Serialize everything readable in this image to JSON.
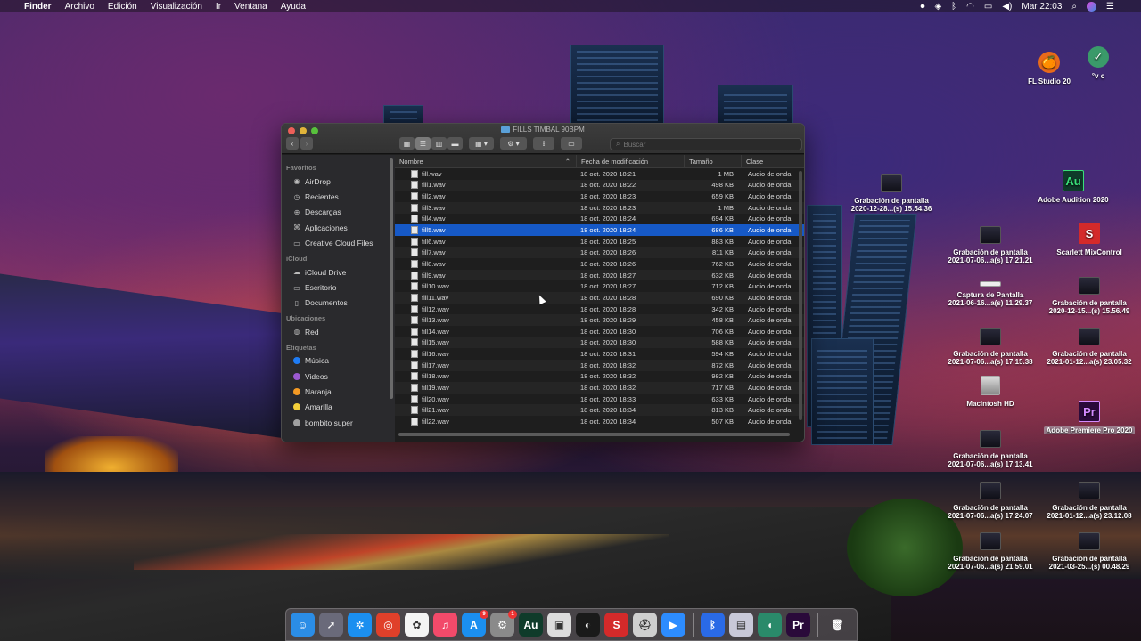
{
  "menubar": {
    "apple": "",
    "app": "Finder",
    "menus": [
      "Archivo",
      "Edición",
      "Visualización",
      "Ir",
      "Ventana",
      "Ayuda"
    ],
    "clock": "Mar 22:03"
  },
  "window": {
    "title": "FILLS TIMBAL 90BPM",
    "search_placeholder": "Buscar"
  },
  "sidebar": {
    "sections": [
      {
        "header": "Favoritos",
        "items": [
          {
            "label": "AirDrop",
            "icon": "airdrop-icon",
            "glyph": "◉"
          },
          {
            "label": "Recientes",
            "icon": "clock-icon",
            "glyph": "◷"
          },
          {
            "label": "Descargas",
            "icon": "download-icon",
            "glyph": "⊕"
          },
          {
            "label": "Aplicaciones",
            "icon": "applications-icon",
            "glyph": "⌘"
          },
          {
            "label": "Creative Cloud Files",
            "icon": "folder-icon",
            "glyph": "▭"
          }
        ]
      },
      {
        "header": "iCloud",
        "items": [
          {
            "label": "iCloud Drive",
            "icon": "cloud-icon",
            "glyph": "☁"
          },
          {
            "label": "Escritorio",
            "icon": "desktop-icon",
            "glyph": "▭"
          },
          {
            "label": "Documentos",
            "icon": "document-icon",
            "glyph": "▯"
          }
        ]
      },
      {
        "header": "Ubicaciones",
        "items": [
          {
            "label": "Red",
            "icon": "network-icon",
            "glyph": "◍"
          }
        ]
      },
      {
        "header": "Etiquetas",
        "items": [
          {
            "label": "Música",
            "tag": "#1e7cf5"
          },
          {
            "label": "Videos",
            "tag": "#9b59d0"
          },
          {
            "label": "Naranja",
            "tag": "#f49a24"
          },
          {
            "label": "Amarilla",
            "tag": "#f4d03a"
          },
          {
            "label": "bombito super",
            "tag": "#a0a0a0"
          }
        ]
      }
    ]
  },
  "columns": {
    "name": "Nombre",
    "date": "Fecha de modificación",
    "size": "Tamaño",
    "kind": "Clase"
  },
  "files": [
    {
      "name": "fill.wav",
      "date": "18 oct. 2020 18:21",
      "size": "1 MB",
      "kind": "Audio de onda"
    },
    {
      "name": "fill1.wav",
      "date": "18 oct. 2020 18:22",
      "size": "498 KB",
      "kind": "Audio de onda"
    },
    {
      "name": "fill2.wav",
      "date": "18 oct. 2020 18:23",
      "size": "659 KB",
      "kind": "Audio de onda"
    },
    {
      "name": "fill3.wav",
      "date": "18 oct. 2020 18:23",
      "size": "1 MB",
      "kind": "Audio de onda"
    },
    {
      "name": "fill4.wav",
      "date": "18 oct. 2020 18:24",
      "size": "694 KB",
      "kind": "Audio de onda"
    },
    {
      "name": "fill5.wav",
      "date": "18 oct. 2020 18:24",
      "size": "686 KB",
      "kind": "Audio de onda",
      "selected": true
    },
    {
      "name": "fill6.wav",
      "date": "18 oct. 2020 18:25",
      "size": "883 KB",
      "kind": "Audio de onda"
    },
    {
      "name": "fill7.wav",
      "date": "18 oct. 2020 18:26",
      "size": "811 KB",
      "kind": "Audio de onda"
    },
    {
      "name": "fill8.wav",
      "date": "18 oct. 2020 18:26",
      "size": "762 KB",
      "kind": "Audio de onda"
    },
    {
      "name": "fill9.wav",
      "date": "18 oct. 2020 18:27",
      "size": "632 KB",
      "kind": "Audio de onda"
    },
    {
      "name": "fill10.wav",
      "date": "18 oct. 2020 18:27",
      "size": "712 KB",
      "kind": "Audio de onda"
    },
    {
      "name": "fill11.wav",
      "date": "18 oct. 2020 18:28",
      "size": "690 KB",
      "kind": "Audio de onda"
    },
    {
      "name": "fill12.wav",
      "date": "18 oct. 2020 18:28",
      "size": "342 KB",
      "kind": "Audio de onda"
    },
    {
      "name": "fill13.wav",
      "date": "18 oct. 2020 18:29",
      "size": "458 KB",
      "kind": "Audio de onda"
    },
    {
      "name": "fill14.wav",
      "date": "18 oct. 2020 18:30",
      "size": "706 KB",
      "kind": "Audio de onda"
    },
    {
      "name": "fill15.wav",
      "date": "18 oct. 2020 18:30",
      "size": "588 KB",
      "kind": "Audio de onda"
    },
    {
      "name": "fill16.wav",
      "date": "18 oct. 2020 18:31",
      "size": "594 KB",
      "kind": "Audio de onda"
    },
    {
      "name": "fill17.wav",
      "date": "18 oct. 2020 18:32",
      "size": "872 KB",
      "kind": "Audio de onda"
    },
    {
      "name": "fill18.wav",
      "date": "18 oct. 2020 18:32",
      "size": "982 KB",
      "kind": "Audio de onda"
    },
    {
      "name": "fill19.wav",
      "date": "18 oct. 2020 18:32",
      "size": "717 KB",
      "kind": "Audio de onda"
    },
    {
      "name": "fill20.wav",
      "date": "18 oct. 2020 18:33",
      "size": "633 KB",
      "kind": "Audio de onda"
    },
    {
      "name": "fill21.wav",
      "date": "18 oct. 2020 18:34",
      "size": "813 KB",
      "kind": "Audio de onda"
    },
    {
      "name": "fill22.wav",
      "date": "18 oct. 2020 18:34",
      "size": "507 KB",
      "kind": "Audio de onda"
    }
  ],
  "desktop": {
    "fl_studio": "FL Studio 20",
    "vc": "°v c",
    "grab1": [
      "Grabación de pantalla",
      "2020-12-28...(s) 15.54.36"
    ],
    "audition": "Adobe Audition 2020",
    "grab2": [
      "Grabación de pantalla",
      "2021-07-06...a(s) 17.21.21"
    ],
    "scarlett": "Scarlett MixControl",
    "captura": [
      "Captura de Pantalla",
      "2021-06-16...a(s) 11.29.37"
    ],
    "grab3": [
      "Grabación de pantalla",
      "2020-12-15...(s) 15.56.49"
    ],
    "grab4": [
      "Grabación de pantalla",
      "2021-07-06...a(s) 17.15.38"
    ],
    "grab5": [
      "Grabación de pantalla",
      "2021-01-12...a(s) 23.05.32"
    ],
    "macintosh": "Macintosh HD",
    "premiere": "Adobe Premiere Pro 2020",
    "grab6": [
      "Grabación de pantalla",
      "2021-07-06...a(s) 17.13.41"
    ],
    "grab7": [
      "Grabación de pantalla",
      "2021-07-06...a(s) 17.24.07"
    ],
    "grab8": [
      "Grabación de pantalla",
      "2021-01-12...a(s) 23.12.08"
    ],
    "grab9": [
      "Grabación de pantalla",
      "2021-07-06...a(s) 21.59.01"
    ],
    "grab10": [
      "Grabación de pantalla",
      "2021-03-25...(s) 00.48.29"
    ]
  },
  "dock": [
    {
      "name": "finder-icon",
      "glyph": "☺",
      "bg": "#2b8de6"
    },
    {
      "name": "launchpad-icon",
      "glyph": "➚",
      "bg": "#6a6a7a"
    },
    {
      "name": "safari-icon",
      "glyph": "✲",
      "bg": "#1b8ff0"
    },
    {
      "name": "chrome-icon",
      "glyph": "◎",
      "bg": "#e0402a"
    },
    {
      "name": "photos-icon",
      "glyph": "✿",
      "bg": "#f4f4f4"
    },
    {
      "name": "music-icon",
      "glyph": "♫",
      "bg": "#f24a6a"
    },
    {
      "name": "app-store-icon",
      "glyph": "A",
      "bg": "#1b8ff0",
      "badge": "9"
    },
    {
      "name": "system-preferences-icon",
      "glyph": "⚙",
      "bg": "#8a8a8a",
      "badge": "1"
    },
    {
      "name": "audition-icon",
      "glyph": "Au",
      "bg": "#0f3b2a"
    },
    {
      "name": "preview-icon",
      "glyph": "▣",
      "bg": "#dcdcdc"
    },
    {
      "name": "speed-icon",
      "glyph": "◐",
      "bg": "#1a1a1a"
    },
    {
      "name": "scarlett-icon",
      "glyph": "S",
      "bg": "#d42a2a"
    },
    {
      "name": "disk-utility-icon",
      "glyph": "⛑",
      "bg": "#cfcfcf"
    },
    {
      "name": "zoom-icon",
      "glyph": "▶",
      "bg": "#2d8cff"
    },
    {
      "name": "bluetooth-icon",
      "glyph": "ᛒ",
      "bg": "#2a6ae6"
    },
    {
      "name": "screenshot-icon",
      "glyph": "▤",
      "bg": "#c8c8d8"
    },
    {
      "name": "edge-icon",
      "glyph": "◖",
      "bg": "#2a8a6a"
    },
    {
      "name": "premiere-icon",
      "glyph": "Pr",
      "bg": "#2a0a3a"
    },
    {
      "name": "trash-icon",
      "glyph": "🗑",
      "bg": "transparent"
    }
  ]
}
